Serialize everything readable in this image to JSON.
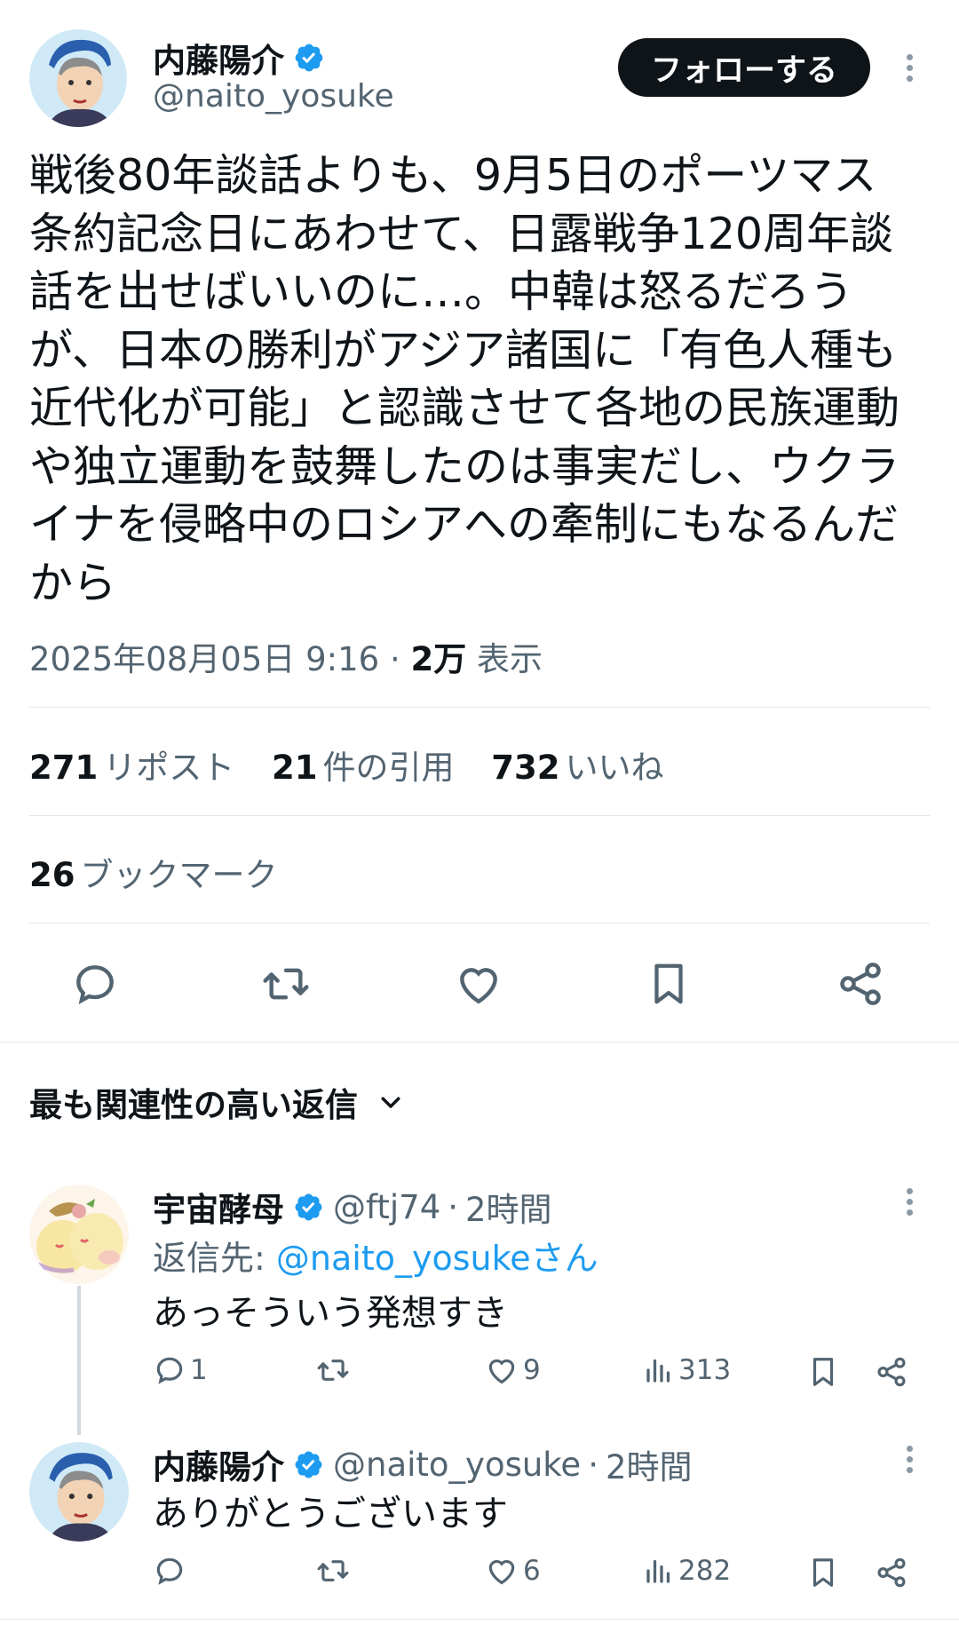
{
  "tweet": {
    "author_name": "内藤陽介",
    "author_handle": "@naito_yosuke",
    "follow_label": "フォローする",
    "text_lines": [
      "戦後80年談話よりも、9月5日のポーツマス",
      "条約記念日にあわせて、日露戦争120周年談",
      "話を出せばいいのに…。中韓は怒るだろう",
      "が、日本の勝利がアジア諸国に「有色人種も",
      "近代化が可能」と認識させて各地の民族運動",
      "や独立運動を鼓舞したのは事実だし、ウクラ",
      "イナを侵略中のロシアへの牽制にもなるんだ",
      "から"
    ],
    "timestamp": "2025年08月05日 9:16",
    "separator": " · ",
    "views_count": "2万",
    "views_label": " 表示",
    "reposts_count": "271",
    "reposts_label": "リポスト",
    "quotes_count": "21",
    "quotes_label": "件の引用",
    "likes_count": "732",
    "likes_label": "いいね",
    "bookmarks_count": "26",
    "bookmarks_label": "ブックマーク"
  },
  "replies_section": {
    "title": "最も関連性の高い返信"
  },
  "replies": [
    {
      "name": "宇宙酵母",
      "handle": "@ftj74",
      "time": "2時間",
      "reply_to_prefix": "返信先: ",
      "reply_to_handle": "@naito_yosukeさん",
      "text": "あっそういう発想すき",
      "replies": "1",
      "retweets": "",
      "likes": "9",
      "views": "313"
    },
    {
      "name": "内藤陽介",
      "handle": "@naito_yosuke",
      "time": "2時間",
      "text": "ありがとうございます",
      "replies": "",
      "retweets": "",
      "likes": "6",
      "views": "282"
    }
  ],
  "colors": {
    "text": "#0f1419",
    "secondary": "#536471",
    "link": "#1d9bf0",
    "verified": "#1d9bf0",
    "divider": "#e1e8ed"
  },
  "icons": [
    "verified-badge-icon",
    "more-icon",
    "reply-icon",
    "retweet-icon",
    "like-icon",
    "bookmark-icon",
    "share-icon",
    "views-icon",
    "chevron-down-icon"
  ]
}
